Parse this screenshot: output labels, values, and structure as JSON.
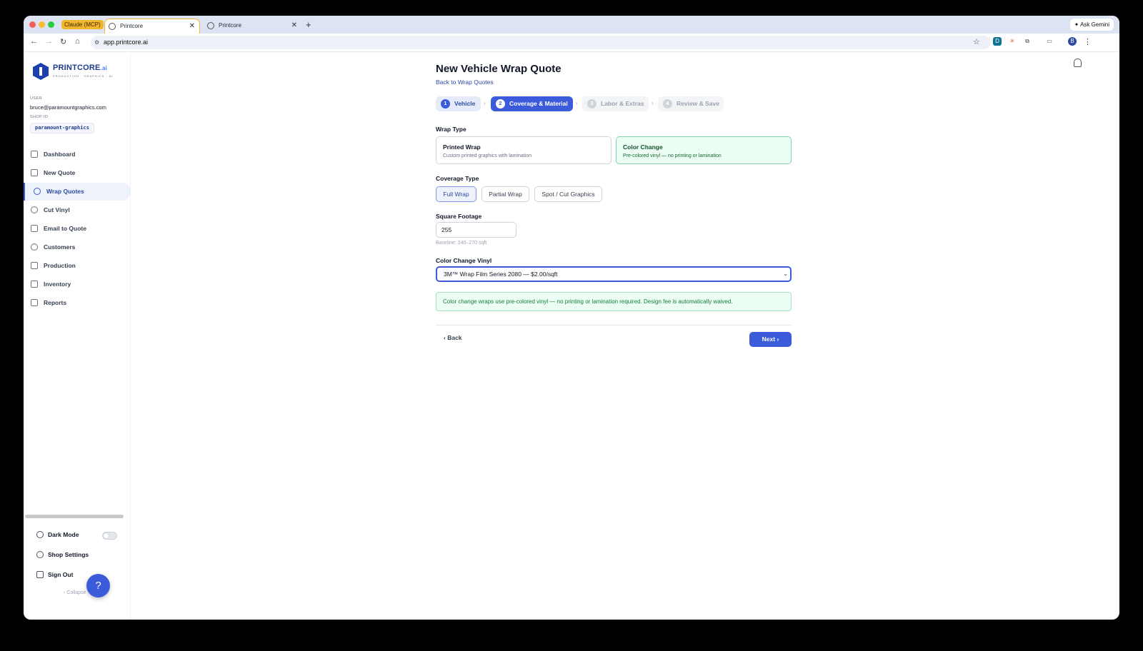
{
  "browser": {
    "tab_group_label": "Claude (MCP)",
    "tabs": [
      {
        "title": "Printcore"
      },
      {
        "title": "Printcore"
      }
    ],
    "new_tab_symbol": "+",
    "ask_gemini": "Ask Gemini",
    "url": "app.printcore.ai",
    "profile_initial": "B"
  },
  "sidebar": {
    "logo_text": "PRINTCORE",
    "logo_suffix": ".ai",
    "logo_tagline": "PRODUCTION · GRAPHICS · AI",
    "user_label": "USER",
    "user_email": "bruce@paramountgraphics.com",
    "shop_label": "SHOP ID",
    "shop_id": "paramount-graphics",
    "items": [
      {
        "label": "Dashboard",
        "icon": "grid-icon"
      },
      {
        "label": "New Quote",
        "icon": "document-icon"
      },
      {
        "label": "Wrap Quotes",
        "icon": "car-icon"
      },
      {
        "label": "Cut Vinyl",
        "icon": "scissors-icon"
      },
      {
        "label": "Email to Quote",
        "icon": "mail-icon"
      },
      {
        "label": "Customers",
        "icon": "users-icon"
      },
      {
        "label": "Production",
        "icon": "factory-icon"
      },
      {
        "label": "Inventory",
        "icon": "box-icon"
      },
      {
        "label": "Reports",
        "icon": "bar-chart-icon"
      }
    ],
    "active_item": "Wrap Quotes",
    "dark_mode_label": "Dark Mode",
    "shop_settings_label": "Shop Settings",
    "sign_out_label": "Sign Out",
    "collapse_label": "Collapse",
    "help_symbol": "?"
  },
  "main": {
    "title": "New Vehicle Wrap Quote",
    "back_link": "Back to Wrap Quotes",
    "steps": [
      {
        "num": "1",
        "label": "Vehicle",
        "state": "done"
      },
      {
        "num": "2",
        "label": "Coverage & Material",
        "state": "current"
      },
      {
        "num": "3",
        "label": "Labor & Extras",
        "state": "future"
      },
      {
        "num": "4",
        "label": "Review & Save",
        "state": "future"
      }
    ],
    "wrap_type_label": "Wrap Type",
    "wrap_types": [
      {
        "title": "Printed Wrap",
        "subtitle": "Custom printed graphics with lamination",
        "selected": false
      },
      {
        "title": "Color Change",
        "subtitle": "Pre-colored vinyl — no printing or lamination",
        "selected": true
      }
    ],
    "coverage_label": "Coverage Type",
    "coverage_types": [
      {
        "label": "Full Wrap",
        "selected": true
      },
      {
        "label": "Partial Wrap",
        "selected": false
      },
      {
        "label": "Spot / Cut Graphics",
        "selected": false
      }
    ],
    "sqft_label": "Square Footage",
    "sqft_value": "255",
    "sqft_hint": "Baseline: 240–270 sqft",
    "vinyl_label": "Color Change Vinyl",
    "vinyl_selected": "3M™ Wrap Film Series 2080 — $2.00/sqft",
    "info_message": "Color change wraps use pre-colored vinyl — no printing or lamination required. Design fee is automatically waived.",
    "back_button": "Back",
    "next_button": "Next"
  }
}
